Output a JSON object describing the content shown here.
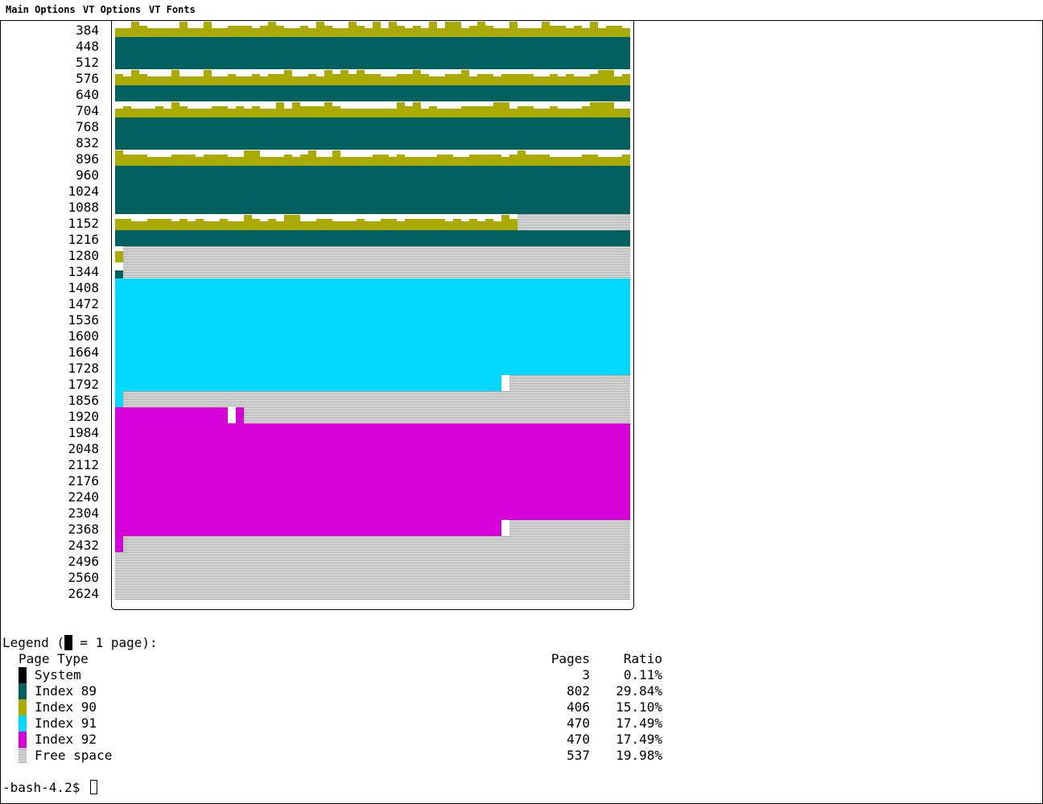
{
  "menubar": {
    "items": [
      "Main Options",
      "VT Options",
      "VT Fonts"
    ]
  },
  "colors": {
    "system": "#000000",
    "index89": "#006060",
    "index90": "#aaaa00",
    "index91": "#00d8ff",
    "index92": "#d800d8",
    "free": "#9a9a9a"
  },
  "page_map": {
    "pages_per_row": 64,
    "row_labels": [
      "384",
      "448",
      "512",
      "576",
      "640",
      "704",
      "768",
      "832",
      "896",
      "960",
      "1024",
      "1088",
      "1152",
      "1216",
      "1280",
      "1344",
      "1408",
      "1472",
      "1536",
      "1600",
      "1664",
      "1728",
      "1792",
      "1856",
      "1920",
      "1984",
      "2048",
      "2112",
      "2176",
      "2240",
      "2304",
      "2368",
      "2432",
      "2496",
      "2560",
      "2624"
    ]
  },
  "legend": {
    "title": "Legend (█ = 1 page):",
    "header": {
      "type": "Page Type",
      "pages": "Pages",
      "ratio": "Ratio"
    },
    "rows": [
      {
        "type": "System",
        "pages": "3",
        "ratio": "0.11%",
        "color": "#000000"
      },
      {
        "type": "Index 89",
        "pages": "802",
        "ratio": "29.84%",
        "color": "#006060"
      },
      {
        "type": "Index 90",
        "pages": "406",
        "ratio": "15.10%",
        "color": "#aaaa00"
      },
      {
        "type": "Index 91",
        "pages": "470",
        "ratio": "17.49%",
        "color": "#00d8ff"
      },
      {
        "type": "Index 92",
        "pages": "470",
        "ratio": "17.49%",
        "color": "#d800d8"
      },
      {
        "type": "Free space",
        "pages": "537",
        "ratio": "19.98%",
        "color": "#9a9a9a"
      }
    ]
  },
  "prompt": {
    "text": "-bash-4.2$ "
  }
}
